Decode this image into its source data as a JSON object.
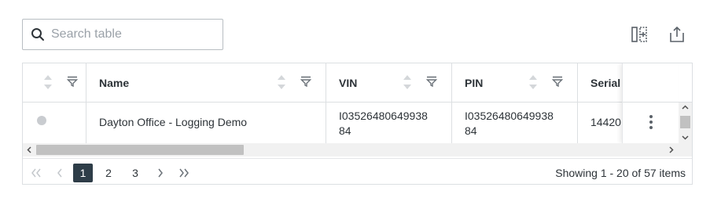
{
  "search": {
    "placeholder": "Search table",
    "value": ""
  },
  "toolbar": {
    "columns_icon": "column-settings-icon",
    "export_icon": "export-icon"
  },
  "table": {
    "columns": [
      {
        "key": "select",
        "label": ""
      },
      {
        "key": "name",
        "label": "Name"
      },
      {
        "key": "vin",
        "label": "VIN"
      },
      {
        "key": "pin",
        "label": "PIN"
      },
      {
        "key": "serial",
        "label": "Serial"
      }
    ],
    "rows": [
      {
        "status": "gray-dot",
        "name": "Dayton Office - Logging Demo",
        "vin_line1": "I03526480649938",
        "vin_line2": "84",
        "pin_line1": "I03526480649938",
        "pin_line2": "84",
        "serial": "14420"
      }
    ]
  },
  "pagination": {
    "pages": [
      "1",
      "2",
      "3"
    ],
    "current": "1",
    "info": "Showing 1 - 20 of 57 items"
  },
  "colors": {
    "border": "#dcdfe2",
    "active_page_bg": "#2e3d48",
    "text": "#2d3338",
    "muted_icon": "#b0b5ba"
  }
}
